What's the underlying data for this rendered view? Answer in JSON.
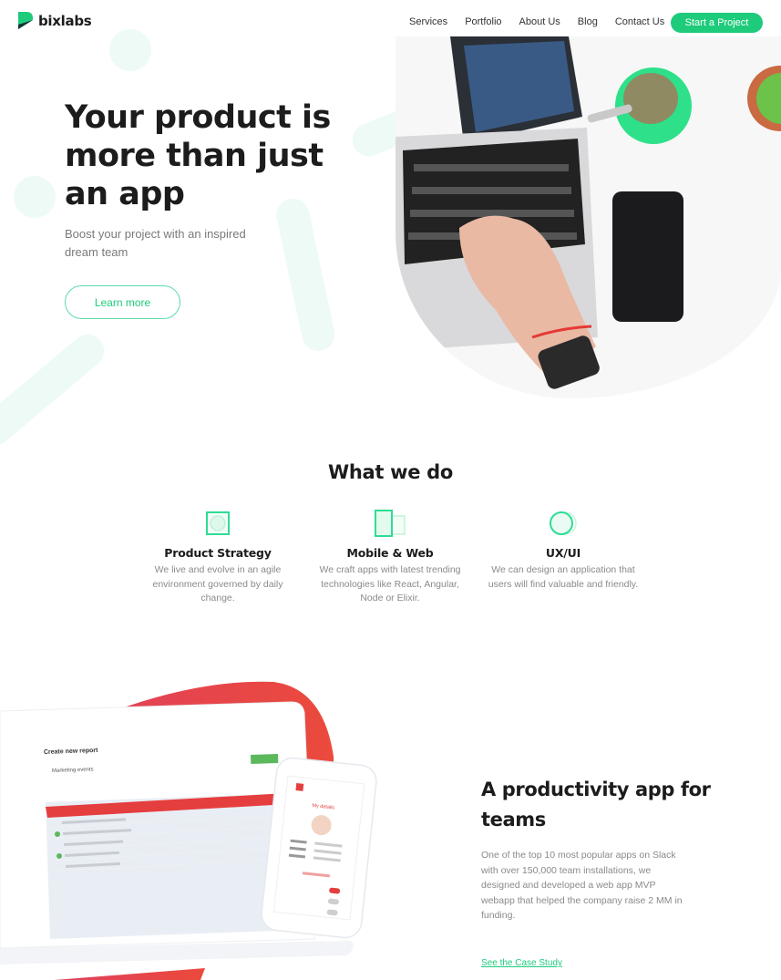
{
  "header": {
    "brand": "bixlabs",
    "nav": [
      "Services",
      "Portfolio",
      "About Us",
      "Blog",
      "Contact Us"
    ],
    "cta_label": "Start a Project"
  },
  "hero": {
    "title": "Your product is more than just an app",
    "subtitle": "Boost your project with an inspired dream team",
    "button_label": "Learn more",
    "image_alt": "hands typing on laptop with phone and plants on desk"
  },
  "what_we_do": {
    "title": "What we do",
    "services": [
      {
        "icon": "strategy-icon",
        "title": "Product Strategy",
        "text": "We live and evolve in an agile environment governed by daily change."
      },
      {
        "icon": "devices-icon",
        "title": "Mobile & Web",
        "text": "We craft apps with latest trending technologies like React, Angular, Node or Elixir."
      },
      {
        "icon": "design-icon",
        "title": "UX/UI",
        "text": "We can design an application that users will find valuable and friendly."
      }
    ]
  },
  "case_study": {
    "title": "A productivity app for teams",
    "body": "One of the top 10 most popular apps on Slack with over 150,000 team installations, we designed and developed a web app MVP webapp that helped the company raise 2 MM in funding.",
    "link_label": "See the Case Study",
    "mockup": {
      "report_title": "Create new report",
      "report_name": "Marketing events",
      "phone_title": "My details"
    }
  },
  "colors": {
    "accent": "#1ecb7b",
    "mint": "#eefaf5",
    "case_red": "#e8434a"
  }
}
